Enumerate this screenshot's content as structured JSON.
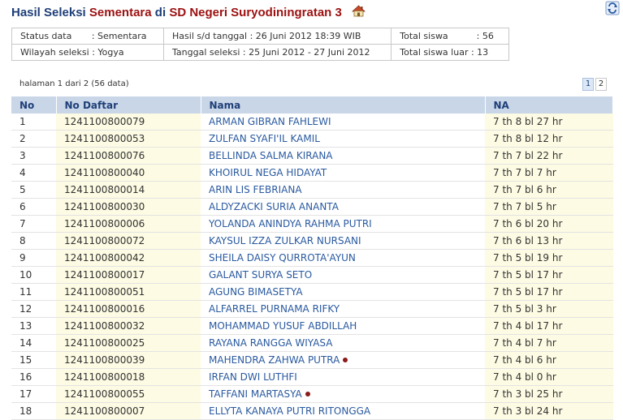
{
  "title": {
    "part1": "Hasil Seleksi",
    "part2": "Sementara",
    "part3": "di",
    "part4": "SD Negeri Suryodiningratan 3"
  },
  "info": {
    "status_label": "Status data",
    "status_value": ": Sementara",
    "hasil_label": "Hasil s/d tanggal",
    "hasil_value": ": 26 Juni 2012 18:39 WIB",
    "total_label": "Total siswa",
    "total_value": ": 56",
    "wilayah_label": "Wilayah seleksi",
    "wilayah_value": ": Yogya",
    "tanggal_label": "Tanggal seleksi",
    "tanggal_value": ":  25 Juni 2012 - 27 Juni 2012",
    "luar_label": "Total siswa luar",
    "luar_value": ": 13"
  },
  "pager": {
    "text": "halaman 1 dari 2 (56 data)",
    "pages": [
      "1",
      "2"
    ],
    "active": "1"
  },
  "table": {
    "headers": [
      "No",
      "No Daftar",
      "Nama",
      "NA"
    ],
    "rows": [
      {
        "no": "1",
        "daftar": "1241100800079",
        "nama": "ARMAN GIBRAN FAHLEWI",
        "na": "7 th 8 bl 27 hr",
        "dot": false
      },
      {
        "no": "2",
        "daftar": "1241100800053",
        "nama": "ZULFAN SYAFI'IL KAMIL",
        "na": "7 th 8 bl 12 hr",
        "dot": false
      },
      {
        "no": "3",
        "daftar": "1241100800076",
        "nama": "BELLINDA SALMA KIRANA",
        "na": "7 th 7 bl 22 hr",
        "dot": false
      },
      {
        "no": "4",
        "daftar": "1241100800040",
        "nama": "KHOIRUL NEGA HIDAYAT",
        "na": "7 th 7 bl 7 hr",
        "dot": false
      },
      {
        "no": "5",
        "daftar": "1241100800014",
        "nama": "ARIN LIS FEBRIANA",
        "na": "7 th 7 bl 6 hr",
        "dot": false
      },
      {
        "no": "6",
        "daftar": "1241100800030",
        "nama": "ALDYZACKI SURIA ANANTA",
        "na": "7 th 7 bl 5 hr",
        "dot": false
      },
      {
        "no": "7",
        "daftar": "1241100800006",
        "nama": "YOLANDA ANINDYA RAHMA PUTRI",
        "na": "7 th 6 bl 20 hr",
        "dot": false
      },
      {
        "no": "8",
        "daftar": "1241100800072",
        "nama": "KAYSUL IZZA ZULKAR NURSANI",
        "na": "7 th 6 bl 13 hr",
        "dot": false
      },
      {
        "no": "9",
        "daftar": "1241100800042",
        "nama": "SHEILA DAISY QURROTA'AYUN",
        "na": "7 th 5 bl 19 hr",
        "dot": false
      },
      {
        "no": "10",
        "daftar": "1241100800017",
        "nama": "GALANT SURYA SETO",
        "na": "7 th 5 bl 17 hr",
        "dot": false
      },
      {
        "no": "11",
        "daftar": "1241100800051",
        "nama": "AGUNG BIMASETYA",
        "na": "7 th 5 bl 17 hr",
        "dot": false
      },
      {
        "no": "12",
        "daftar": "1241100800016",
        "nama": "ALFARREL PURNAMA RIFKY",
        "na": "7 th 5 bl 3 hr",
        "dot": false
      },
      {
        "no": "13",
        "daftar": "1241100800032",
        "nama": "MOHAMMAD YUSUF ABDILLAH",
        "na": "7 th 4 bl 17 hr",
        "dot": false
      },
      {
        "no": "14",
        "daftar": "1241100800025",
        "nama": "RAYANA RANGGA WIYASA",
        "na": "7 th 4 bl 7 hr",
        "dot": false
      },
      {
        "no": "15",
        "daftar": "1241100800039",
        "nama": "MAHENDRA ZAHWA PUTRA",
        "na": "7 th 4 bl 6 hr",
        "dot": true
      },
      {
        "no": "16",
        "daftar": "1241100800018",
        "nama": "IRFAN DWI LUTHFI",
        "na": "7 th 4 bl 0 hr",
        "dot": false
      },
      {
        "no": "17",
        "daftar": "1241100800055",
        "nama": "TAFFANI MARTASYA",
        "na": "7 th 3 bl 25 hr",
        "dot": true
      },
      {
        "no": "18",
        "daftar": "1241100800007",
        "nama": "ELLYTA KANAYA PUTRI RITONGGA",
        "na": "7 th 3 bl 24 hr",
        "dot": false
      }
    ]
  },
  "colors": {
    "accent": "#1f3f78",
    "highlight": "#9c1010",
    "header_bg": "#c9d6e8",
    "cell_yellow": "#fdfbe3",
    "link": "#2a5aa0"
  },
  "icons": {
    "title": "home-icon",
    "corner": "refresh-icon",
    "marker": "dot-icon"
  }
}
